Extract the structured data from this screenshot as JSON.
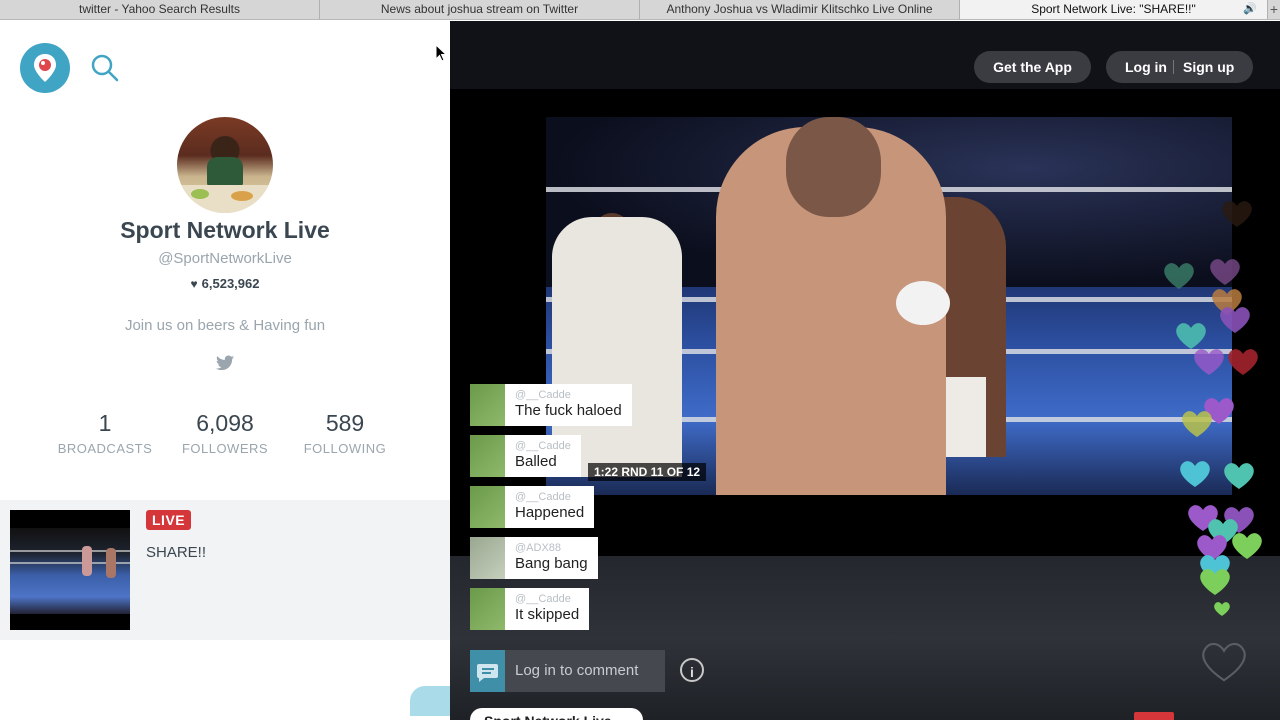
{
  "browser": {
    "tabs": [
      {
        "title": "twitter - Yahoo Search Results"
      },
      {
        "title": "News about joshua stream on Twitter"
      },
      {
        "title": "Anthony Joshua vs Wladimir Klitschko Live Online"
      },
      {
        "title": "Sport Network Live: \"SHARE!!\""
      }
    ],
    "new_tab": "+"
  },
  "profile": {
    "name": "Sport Network Live",
    "handle": "@SportNetworkLive",
    "hearts": "6,523,962",
    "bio": "Join us on beers & Having fun",
    "stats": [
      {
        "value": "1",
        "label": "BROADCASTS"
      },
      {
        "value": "6,098",
        "label": "FOLLOWERS"
      },
      {
        "value": "589",
        "label": "FOLLOWING"
      }
    ]
  },
  "broadcast": {
    "badge": "LIVE",
    "title": "SHARE!!"
  },
  "player": {
    "get_app": "Get the App",
    "login": "Log in",
    "signup": "Sign up",
    "clock": "1:22  RND 11 OF 12",
    "comment_placeholder": "Log in to comment",
    "info_glyph": "i",
    "bottom_pill": "Sport Network Live"
  },
  "chat": [
    {
      "user": "@__Cadde",
      "text": "The fuck haloed"
    },
    {
      "user": "@__Cadde",
      "text": "Balled"
    },
    {
      "user": "@__Cadde",
      "text": "Happened"
    },
    {
      "user": "@ADX88",
      "text": "Bang bang"
    },
    {
      "user": "@__Cadde",
      "text": "It skipped"
    }
  ],
  "colors": {
    "accent": "#40a4c4",
    "live": "#d5363a",
    "heart_green": "#7ccf5a",
    "heart_purple": "#9b59c9",
    "heart_teal": "#4fc3b0"
  }
}
